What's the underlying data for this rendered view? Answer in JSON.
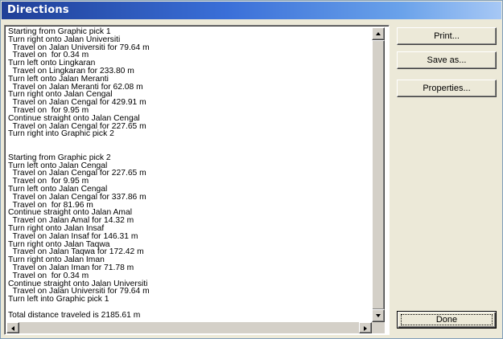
{
  "window": {
    "title": "Directions"
  },
  "directions": {
    "lines": [
      "Starting from Graphic pick 1",
      "Turn right onto Jalan Universiti",
      "  Travel on Jalan Universiti for 79.64 m",
      "  Travel on  for 0.34 m",
      "Turn left onto Lingkaran",
      "  Travel on Lingkaran for 233.80 m",
      "Turn left onto Jalan Meranti",
      "  Travel on Jalan Meranti for 62.08 m",
      "Turn right onto Jalan Cengal",
      "  Travel on Jalan Cengal for 429.91 m",
      "  Travel on  for 9.95 m",
      "Continue straight onto Jalan Cengal",
      "  Travel on Jalan Cengal for 227.65 m",
      "Turn right into Graphic pick 2",
      "",
      "",
      "Starting from Graphic pick 2",
      "Turn left onto Jalan Cengal",
      "  Travel on Jalan Cengal for 227.65 m",
      "  Travel on  for 9.95 m",
      "Turn left onto Jalan Cengal",
      "  Travel on Jalan Cengal for 337.86 m",
      "  Travel on  for 81.96 m",
      "Continue straight onto Jalan Amal",
      "  Travel on Jalan Amal for 14.32 m",
      "Turn right onto Jalan Insaf",
      "  Travel on Jalan Insaf for 146.31 m",
      "Turn right onto Jalan Taqwa",
      "  Travel on Jalan Taqwa for 172.42 m",
      "Turn right onto Jalan Iman",
      "  Travel on Jalan Iman for 71.78 m",
      "  Travel on  for 0.34 m",
      "Continue straight onto Jalan Universiti",
      "  Travel on Jalan Universiti for 79.64 m",
      "Turn left into Graphic pick 1",
      "",
      "Total distance traveled is 2185.61 m"
    ]
  },
  "buttons": {
    "print": "Print...",
    "save_as": "Save as...",
    "properties": "Properties...",
    "done": "Done"
  }
}
